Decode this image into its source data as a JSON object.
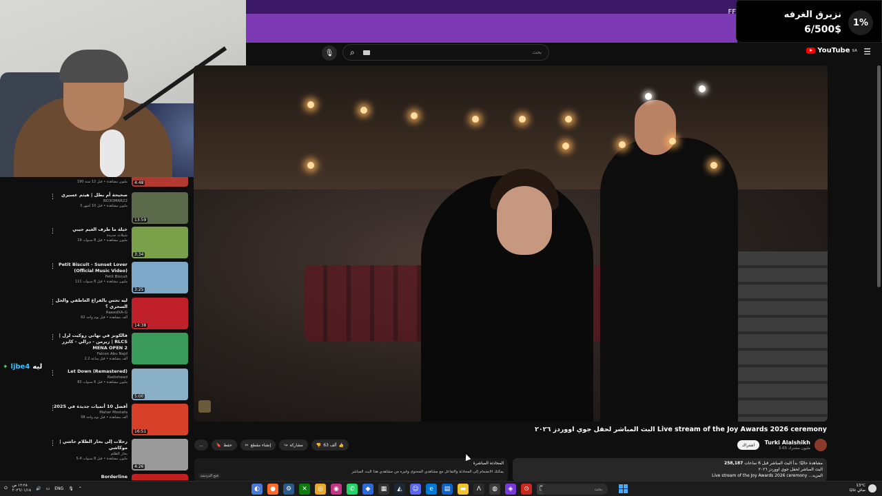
{
  "banner": {
    "tag": "FF"
  },
  "goal": {
    "title": "نزبرق الغرفه",
    "amount": "6/500$",
    "percent": "1%"
  },
  "youtube": {
    "search_placeholder": "بحث",
    "logo_text": "YouTube",
    "logo_region": "SA"
  },
  "recommendations": [
    {
      "title": "",
      "channel": "",
      "views": "190 مليون مشاهدة • قبل 12 سنة",
      "duration": "4:48",
      "color": "#b23a30"
    },
    {
      "title": "صحيحة أم بطل | هيثم عسيري",
      "channel": "BO3OMAR22",
      "views": "3 مليون مشاهدة • قبل 10 أشهر",
      "duration": "13:59",
      "color": "#5a6a4a"
    },
    {
      "title": "خيلة ما طرف الغيم جيبي",
      "channel": "شيلات جديدة",
      "views": "19 مليون مشاهدة • قبل 8 سنوات",
      "duration": "3:34",
      "color": "#7aa04a"
    },
    {
      "title": "Petit Biscuit - Sunset Lover (Official Music Video)",
      "channel": "Petit Biscuit",
      "views": "111 مليون مشاهدة • قبل 8 سنوات",
      "duration": "3:25",
      "color": "#7ea8c8"
    },
    {
      "title": "ليه تحس بالفراغ العاطفي والحل السحري ؟",
      "channel": "RaeedXA-G",
      "views": "62 ألف مشاهدة • قبل يوم واحد",
      "duration": "14:38",
      "color": "#c0202a"
    },
    {
      "title": "فالكونز في تهاني زوكيت لرل | زيرمن - درالي - كايزر | RLCS MENA OPEN 2",
      "channel": "Falcon Abu Najd",
      "views": "2.2 ألف مشاهدة • قبل ساعة",
      "duration": "",
      "color": "#3a9a5a"
    },
    {
      "title": "Let Down (Remastered)",
      "channel": "Radiohead",
      "views": "83 مليون مشاهدة • قبل 6 سنوات",
      "duration": "5:00",
      "color": "#8ab0c8"
    },
    {
      "title": "أفضل 10 أنميات جديدة في 2025",
      "channel": "Maher Mostafa",
      "views": "58 ألف مشاهدة • قبل يوم واحد",
      "duration": "16:51",
      "color": "#d8402a"
    },
    {
      "title": "رحلات إلى بحار الظلام حاشي | موكاشي",
      "channel": "بحار الظلم",
      "views": "5.4 مليون مشاهدة • قبل 8 سنوات",
      "duration": "4:26",
      "color": "#9a9a9a"
    },
    {
      "title": "Borderline",
      "channel": "",
      "views": "",
      "duration": "",
      "color": "#c02020"
    }
  ],
  "chat": {
    "message": "ليه",
    "user": "ljbe4"
  },
  "video": {
    "title": "البث المباشر لحفل جوي اووردز ٢٠٢٦ Live stream of the Joy Awards 2026 ceremony",
    "channel": "Turki Alalshikh",
    "subscribers": "3.65 مليون مشترك",
    "subscribe_label": "اشتراك",
    "likes": "63 ألف",
    "share_label": "مشاركة",
    "clip_label": "إنشاء مقطع",
    "save_label": "حفظ",
    "more_label": "..."
  },
  "description": {
    "line1_count": "258,187",
    "line1_rest": "مشاهدة حاليًا؛ بدأ البث المباشر قبل 6 ساعات",
    "line2": "البث المباشر لحفل جوي اووردز ٢٠٢٦",
    "line3": "Live stream of the Joy Awards 2026 ceremony ...المزيد"
  },
  "live_chat": {
    "heading": "المحادثة المباشرة",
    "prompt": "يمكنك الانضمام إلى المحادثة والتفاعل مع مشاهدي المحتوى وغيره من مشاهدي هذا البث المباشر",
    "open_label": "فتح الدردشة"
  },
  "taskbar": {
    "time": "١٢:٢٨ ص",
    "date": "٢٠٢٦/٠١/١٨",
    "lang": "ENG",
    "search_placeholder": "بحث",
    "temperature": "13°C",
    "weather": "صافٍ غالبًا"
  }
}
